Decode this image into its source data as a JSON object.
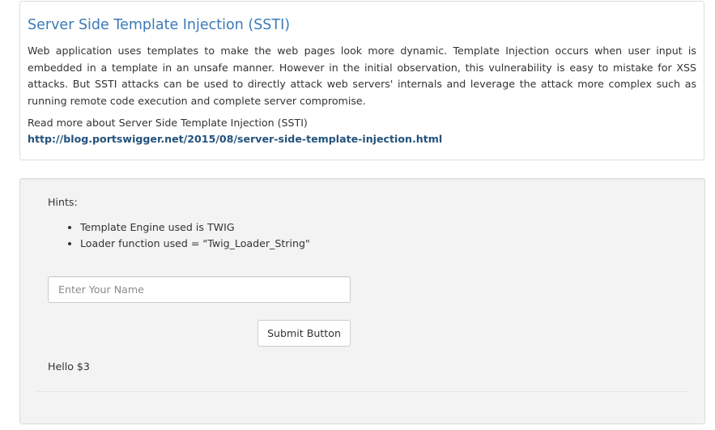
{
  "info": {
    "title": "Server Side Template Injection (SSTI)",
    "description": "Web application uses templates to make the web pages look more dynamic. Template Injection occurs when user input is embedded in a template in an unsafe manner. However in the initial observation, this vulnerability is easy to mistake for XSS attacks. But SSTI attacks can be used to directly attack web servers' internals and leverage the attack more complex such as running remote code execution and complete server compromise.",
    "read_more": "Read more about Server Side Template Injection (SSTI)",
    "link_text": "http://blog.portswigger.net/2015/08/server-side-template-injection.html"
  },
  "form": {
    "hints_label": "Hints:",
    "hints": [
      "Template Engine used is TWIG",
      "Loader function used = \"Twig_Loader_String\""
    ],
    "name_placeholder": "Enter Your Name",
    "name_value": "",
    "submit_label": "Submit Button",
    "result": "Hello $3"
  },
  "colors": {
    "title": "#3a7ab8",
    "link": "#23527c",
    "panel_background": "#f3f3f3"
  }
}
